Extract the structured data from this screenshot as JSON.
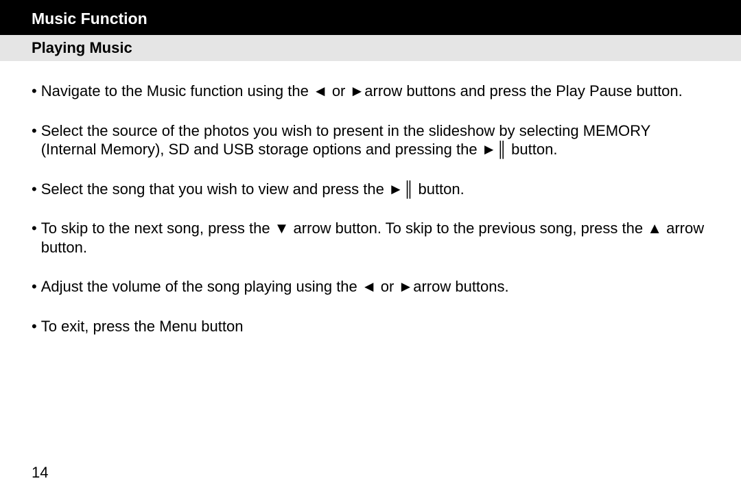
{
  "header": {
    "title": "Music Function"
  },
  "subheader": {
    "title": "Playing Music"
  },
  "bullets": {
    "b1": "Navigate to the Music function using the ◄ or ►arrow buttons and press the Play Pause button.",
    "b2": "Select the source of the photos you wish to present in the slideshow by selecting MEMORY (Internal Memory), SD and USB storage options and pressing the ►║ button.",
    "b3": "Select the song that you wish to view and press the ►║ button.",
    "b4": "To skip to the next song, press the ▼ arrow button.  To skip to the previous song, press the ▲ arrow button.",
    "b5": "Adjust the volume of the song playing using the ◄ or ►arrow buttons.",
    "b6": "To exit, press the Menu button"
  },
  "page_number": "14"
}
